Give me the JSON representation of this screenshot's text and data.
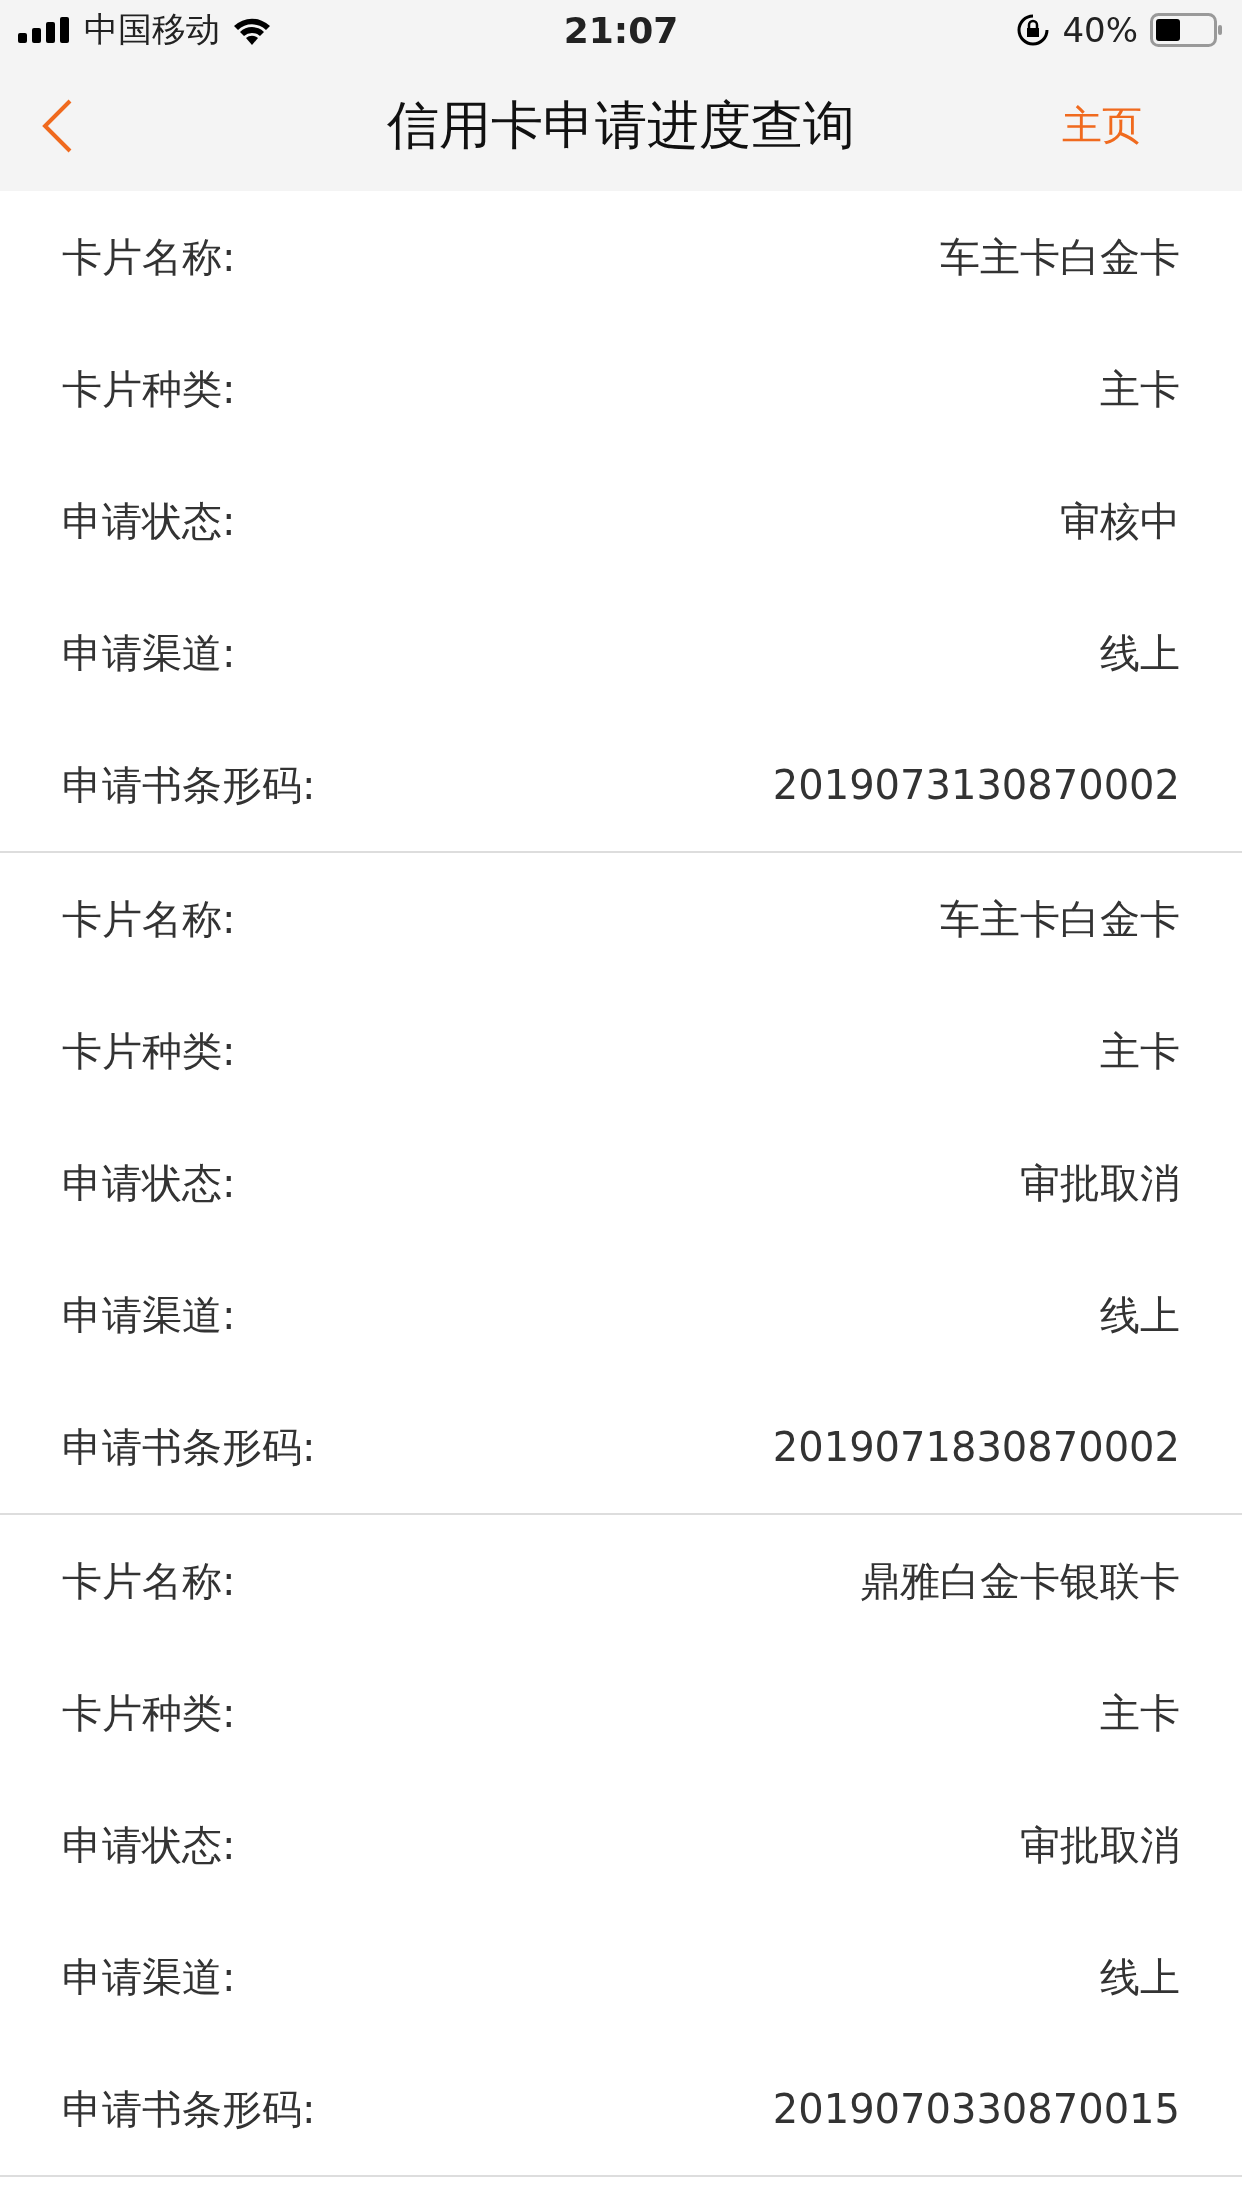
{
  "status_bar": {
    "carrier": "中国移动",
    "time": "21:07",
    "battery": "40%"
  },
  "nav": {
    "title": "信用卡申请进度查询",
    "home": "主页"
  },
  "applications": [
    {
      "fields": [
        {
          "label": "卡片名称:",
          "value": "车主卡白金卡"
        },
        {
          "label": "卡片种类:",
          "value": "主卡"
        },
        {
          "label": "申请状态:",
          "value": "审核中"
        },
        {
          "label": "申请渠道:",
          "value": "线上"
        },
        {
          "label": "申请书条形码:",
          "value": "2019073130870002"
        }
      ]
    },
    {
      "fields": [
        {
          "label": "卡片名称:",
          "value": "车主卡白金卡"
        },
        {
          "label": "卡片种类:",
          "value": "主卡"
        },
        {
          "label": "申请状态:",
          "value": "审批取消"
        },
        {
          "label": "申请渠道:",
          "value": "线上"
        },
        {
          "label": "申请书条形码:",
          "value": "2019071830870002"
        }
      ]
    },
    {
      "fields": [
        {
          "label": "卡片名称:",
          "value": "鼎雅白金卡银联卡"
        },
        {
          "label": "卡片种类:",
          "value": "主卡"
        },
        {
          "label": "申请状态:",
          "value": "审批取消"
        },
        {
          "label": "申请渠道:",
          "value": "线上"
        },
        {
          "label": "申请书条形码:",
          "value": "2019070330870015"
        }
      ]
    }
  ]
}
